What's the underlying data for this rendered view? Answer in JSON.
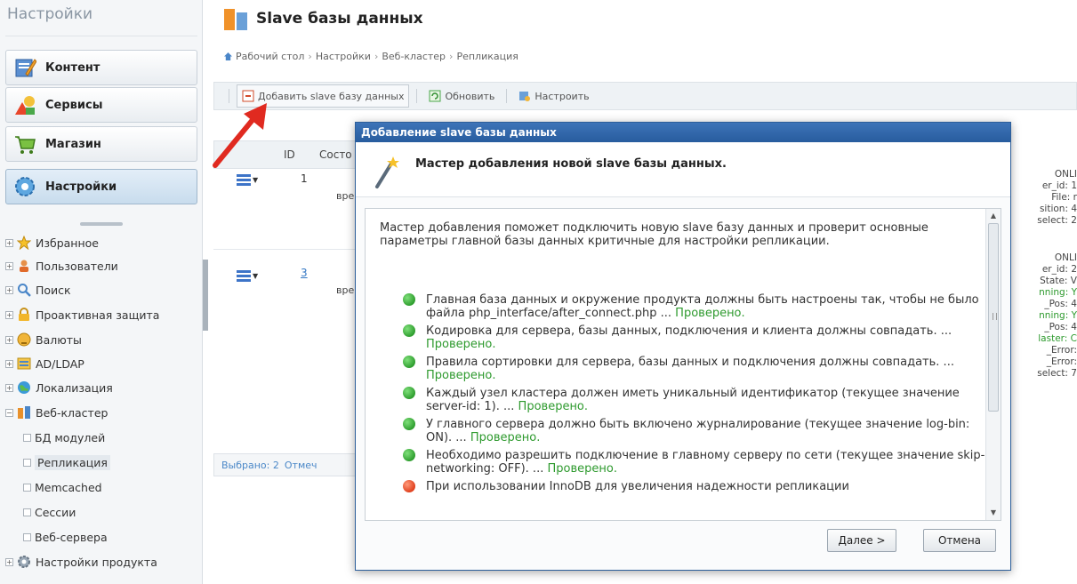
{
  "sidebar": {
    "title": "Настройки",
    "buttons": [
      {
        "label": "Контент",
        "icon": "content-icon"
      },
      {
        "label": "Сервисы",
        "icon": "services-icon"
      },
      {
        "label": "Магазин",
        "icon": "shop-icon"
      },
      {
        "label": "Настройки",
        "icon": "settings-icon",
        "active": true
      }
    ],
    "tree": [
      {
        "label": "Избранное",
        "icon": "star-icon"
      },
      {
        "label": "Пользователи",
        "icon": "users-icon"
      },
      {
        "label": "Поиск",
        "icon": "search-icon"
      },
      {
        "label": "Проактивная защита",
        "icon": "lock-icon"
      },
      {
        "label": "Валюты",
        "icon": "currency-icon"
      },
      {
        "label": "AD/LDAP",
        "icon": "ldap-icon"
      },
      {
        "label": "Локализация",
        "icon": "globe-icon"
      },
      {
        "label": "Веб-кластер",
        "icon": "cluster-icon"
      },
      {
        "label": "БД модулей"
      },
      {
        "label": "Репликация",
        "selected": true
      },
      {
        "label": "Memcached"
      },
      {
        "label": "Сессии"
      },
      {
        "label": "Веб-сервера"
      },
      {
        "label": "Настройки продукта",
        "icon": "gear-icon"
      }
    ]
  },
  "page": {
    "title": "Slave базы данных",
    "breadcrumb": [
      "Рабочий стол",
      "Настройки",
      "Веб-кластер",
      "Репликация"
    ]
  },
  "toolbar": {
    "add_label": "Добавить slave базу данных",
    "refresh_label": "Обновить",
    "configure_label": "Настроить"
  },
  "grid": {
    "columns": [
      "ID",
      "Состо"
    ],
    "rows": [
      {
        "id": "1",
        "time": "вре"
      },
      {
        "id": "3",
        "time": "вре"
      }
    ],
    "footer_selected": "Выбрано: 2",
    "footer_mark": "Отмеч"
  },
  "right_column": {
    "row1": [
      "ONLI",
      "er_id: 1",
      "File: r",
      "sition: 4",
      "select: 2"
    ],
    "row2": [
      "ONLI",
      "er_id: 2",
      "State: V",
      "nning: Y",
      "_Pos: 4",
      "nning: Y",
      "_Pos: 4",
      "laster: C",
      "_Error:",
      "_Error:",
      "select: 7"
    ]
  },
  "dialog": {
    "title": "Добавление slave базы данных",
    "heading": "Мастер добавления новой slave базы данных.",
    "intro": "Мастер добавления поможет подключить новую slave базу данных и проверит основные параметры главной базы данных критичные для настройки репликации.",
    "checks": [
      {
        "text": "Главная база данных и окружение продукта должны быть настроены так, чтобы не было файла php_interface/after_connect.php ...",
        "status": "Проверено.",
        "color": "green"
      },
      {
        "text": "Кодировка для сервера, базы данных, подключения и клиента должны совпадать. ...",
        "status": "Проверено.",
        "color": "green"
      },
      {
        "text": "Правила сортировки для сервера, базы данных и подключения должны совпадать. ...",
        "status": "Проверено.",
        "color": "green"
      },
      {
        "text": "Каждый узел кластера должен иметь уникальный идентификатор (текущее значение server-id: 1). ...",
        "status": "Проверено.",
        "color": "green"
      },
      {
        "text": "У главного сервера должно быть включено журналирование (текущее значение log-bin: ON). ...",
        "status": "Проверено.",
        "color": "green"
      },
      {
        "text": "Необходимо разрешить подключение в главному серверу по сети (текущее значение skip-networking: OFF). ...",
        "status": "Проверено.",
        "color": "green"
      },
      {
        "text": "При использовании InnoDB для увеличения надежности репликации",
        "status": "",
        "color": "red"
      }
    ],
    "next_label": "Далее >",
    "cancel_label": "Отмена"
  }
}
